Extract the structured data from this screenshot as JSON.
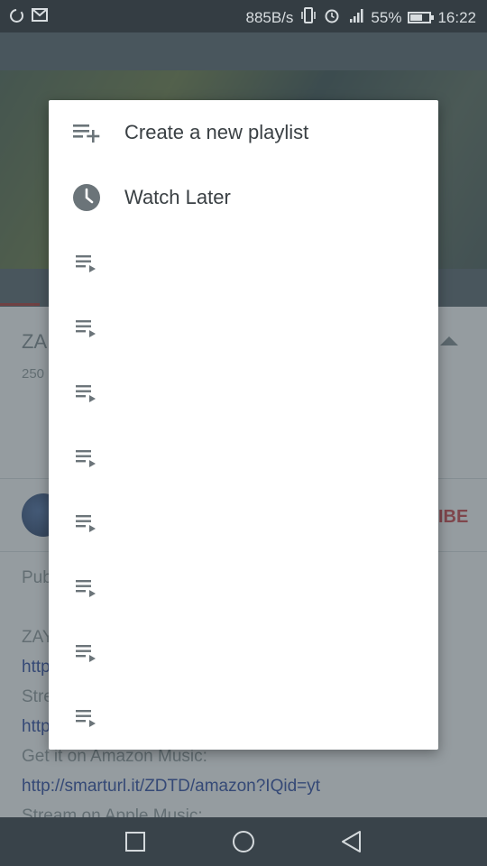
{
  "status_bar": {
    "network_speed": "885B/s",
    "battery_percent": "55%",
    "battery_level": 0.55,
    "time": "16:22",
    "icons": [
      "sync-icon",
      "gmail-icon",
      "vibrate-icon",
      "alarm-icon",
      "signal-icon",
      "battery-icon"
    ]
  },
  "background": {
    "video_title_partial": "ZA",
    "views_partial": "250",
    "subscribe_partial": "IBE",
    "published_partial": "Pub",
    "desc_line1_partial": "ZAY",
    "desc_link1_partial": "http",
    "desc_line2_partial": "Stre",
    "desc_link2_partial": "http",
    "desc_amazon": "Get it on Amazon Music:",
    "desc_amazon_link": "http://smarturl.it/ZDTD/amazon?IQid=yt",
    "desc_apple_partial": "Stream on Apple Music:"
  },
  "dialog": {
    "create_label": "Create a new playlist",
    "watch_later_label": "Watch Later",
    "playlist_count": 8
  },
  "nav_bar": {
    "icons": [
      "recents-square-icon",
      "home-circle-icon",
      "back-triangle-icon"
    ]
  },
  "colors": {
    "status_bar": "#343d43",
    "nav_bar": "#39434a",
    "accent_red": "#c2444a",
    "link_blue": "#2e4a9e",
    "dialog_text": "#3a4044",
    "icon_gray": "#6b7479"
  }
}
